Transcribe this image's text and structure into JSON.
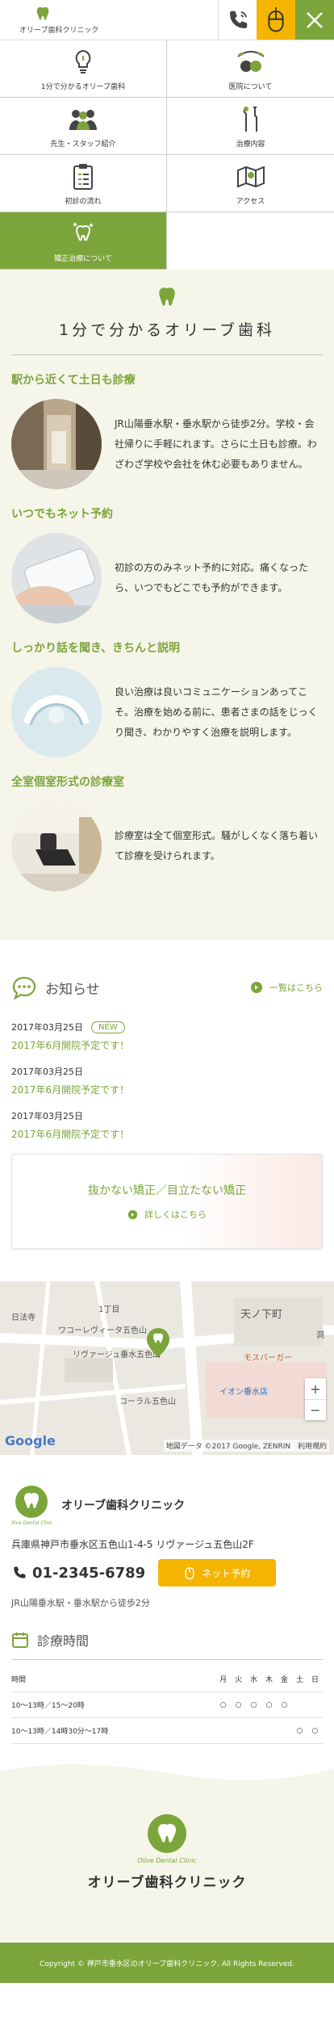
{
  "header": {
    "logo_text": "オリーブ歯科クリニック",
    "logo_small": "Olive Dental Clinic"
  },
  "menu": [
    {
      "label": "1分で分かるオリーブ歯科",
      "icon": "lightbulb-icon"
    },
    {
      "label": "医院について",
      "icon": "olive-icon"
    },
    {
      "label": "先生・スタッフ紹介",
      "icon": "staff-icon"
    },
    {
      "label": "治療内容",
      "icon": "dental-tools-icon"
    },
    {
      "label": "初診の流れ",
      "icon": "clipboard-icon"
    },
    {
      "label": "アクセス",
      "icon": "map-icon"
    },
    {
      "label": "矯正治療について",
      "icon": "sparkle-tooth-icon"
    }
  ],
  "intro": {
    "title": "1分で分かるオリーブ歯科",
    "features": [
      {
        "title": "駅から近くて土日も診療",
        "text": "JR山陽垂水駅・垂水駅から徒歩2分。学校・会社帰りに手軽にれます。さらに土日も診療。わざわざ学校や会社を休む必要もありません。"
      },
      {
        "title": "いつでもネット予約",
        "text": "初診の方のみネット予約に対応。痛くなったら、いつでもどこでも予約ができます。"
      },
      {
        "title": "しっかり話を聞き、きちんと説明",
        "text": "良い治療は良いコミュニケーションあってこそ。治療を始める前に、患者さまの話をじっくり聞き、わかりやすく治療を説明します。"
      },
      {
        "title": "全室個室形式の診療室",
        "text": "診療室は全て個室形式。騒がしくなく落ち着いて診療を受けられます。"
      }
    ]
  },
  "news": {
    "heading": "お知らせ",
    "more": "一覧はこちら",
    "items": [
      {
        "date": "2017年03月25日",
        "badge": "NEW",
        "title": "2017年6月開院予定です！"
      },
      {
        "date": "2017年03月25日",
        "badge": "",
        "title": "2017年6月開院予定です！"
      },
      {
        "date": "2017年03月25日",
        "badge": "",
        "title": "2017年6月開院予定です！"
      }
    ],
    "banner_title": "抜かない矯正／目立たない矯正",
    "banner_link": "詳しくはこちら"
  },
  "map": {
    "labels": {
      "a": "日法寺",
      "b": "ワコーレヴィータ五色山",
      "c": "リヴァージュ垂水五色山",
      "d": "天ノ下町",
      "e": "モスバーガー",
      "f": "イオン垂水店",
      "g": "コーラル五色山",
      "h": "1丁目",
      "i": "洞"
    },
    "google": "Google",
    "attribution": "地図データ ©2017 Google, ZENRIN",
    "terms": "利用規約"
  },
  "clinic": {
    "name": "オリーブ歯科クリニック",
    "address": "兵庫県神戸市垂水区五色山1-4-5 リヴァージュ五色山2F",
    "tel": "01-2345-6789",
    "net_button": "ネット予約",
    "access": "JR山陽垂水駅・垂水駅から徒歩2分",
    "hours_heading": "診療時間",
    "hours_table": {
      "headers": [
        "時間",
        "月",
        "火",
        "水",
        "木",
        "金",
        "土",
        "日"
      ],
      "rows": [
        [
          "10～13時／15～20時",
          "○",
          "○",
          "○",
          "○",
          "○",
          "",
          ""
        ],
        [
          "10～13時／14時30分～17時",
          "",
          "",
          "",
          "",
          "",
          "○",
          "○"
        ]
      ]
    }
  },
  "footer": {
    "sub": "Olive Dental Clinic",
    "name": "オリーブ歯科クリニック",
    "copyright": "Copyright © 神戸市垂水区のオリーブ歯科クリニック. All Rights Reserved."
  },
  "colors": {
    "green": "#7ba53a",
    "yellow": "#f4b400",
    "beige": "#f6f5ea"
  }
}
